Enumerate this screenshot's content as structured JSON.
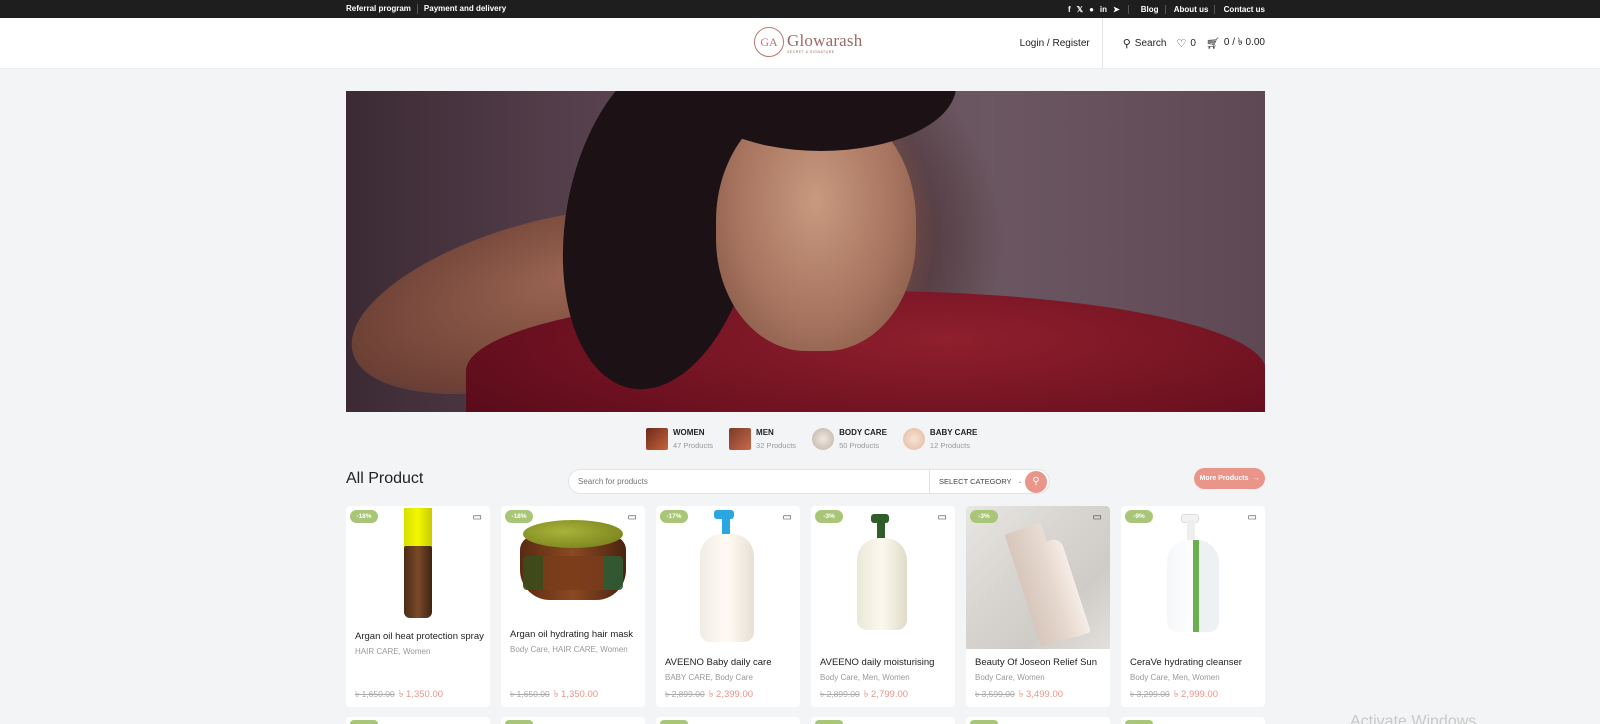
{
  "topbar": {
    "left_links": [
      "Referral program",
      "Payment and delivery"
    ],
    "social_icons": [
      "facebook-icon",
      "x-icon",
      "pinterest-icon",
      "linkedin-icon",
      "telegram-icon"
    ],
    "right_links": [
      "Blog",
      "About us",
      "Contact us"
    ]
  },
  "header": {
    "logo_name": "Glowarash",
    "logo_initials": "GA",
    "logo_tagline": "SECRET & SIGNATURE",
    "login_label": "Login / Register",
    "search_label": "Search",
    "wishlist_count": "0",
    "cart_label": "0 / ৳ 0.00"
  },
  "categories": [
    {
      "name": "WOMEN",
      "count": "47 Products"
    },
    {
      "name": "MEN",
      "count": "32 Products"
    },
    {
      "name": "BODY CARE",
      "count": "50 Products"
    },
    {
      "name": "BABY CARE",
      "count": "12 Products"
    }
  ],
  "section": {
    "title": "All Product",
    "search_placeholder": "Search for products",
    "category_select": "SELECT CATEGORY",
    "more_button": "More Products"
  },
  "products": [
    {
      "badge": "-18%",
      "name": "Argan oil heat protection spray",
      "cats": "HAIR CARE, Women",
      "old_price": "৳ 1,650.00",
      "price": "৳ 1,350.00"
    },
    {
      "badge": "-18%",
      "name": "Argan oil hydrating hair mask",
      "cats": "Body Care, HAIR CARE, Women",
      "old_price": "৳ 1,650.00",
      "price": "৳ 1,350.00"
    },
    {
      "badge": "-17%",
      "name": "AVEENO Baby daily care",
      "cats": "BABY CARE, Body Care",
      "old_price": "৳ 2,899.00",
      "price": "৳ 2,399.00"
    },
    {
      "badge": "-3%",
      "name": "AVEENO daily moisturising",
      "cats": "Body Care, Men, Women",
      "old_price": "৳ 2,899.00",
      "price": "৳ 2,799.00"
    },
    {
      "badge": "-3%",
      "name": "Beauty Of Joseon Relief Sun",
      "cats": "Body Care, Women",
      "old_price": "৳ 3,599.00",
      "price": "৳ 3,499.00"
    },
    {
      "badge": "-9%",
      "name": "CeraVe hydrating cleanser",
      "cats": "Body Care, Men, Women",
      "old_price": "৳ 3,299.00",
      "price": "৳ 2,999.00"
    }
  ],
  "watermark": "Activate Windows",
  "colors": {
    "accent": "#e9958a",
    "badge": "#a9c577",
    "topbar": "#1e1e1e"
  }
}
